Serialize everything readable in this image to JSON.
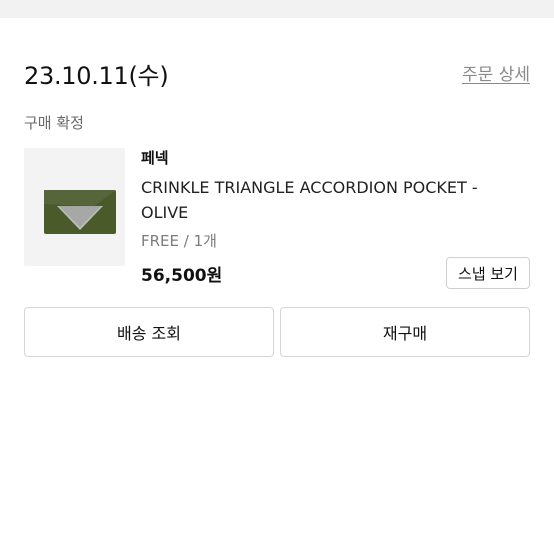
{
  "order": {
    "date": "23.10.11(수)",
    "detail_link": "주문 상세",
    "status": "구매 확정"
  },
  "product": {
    "brand": "페넥",
    "name": "CRINKLE TRIANGLE ACCORDION POCKET - OLIVE",
    "option": "FREE / 1개",
    "price": "56,500원",
    "image_color": "#4b5a2a"
  },
  "buttons": {
    "snap": "스냅 보기",
    "track": "배송 조회",
    "reorder": "재구매"
  }
}
